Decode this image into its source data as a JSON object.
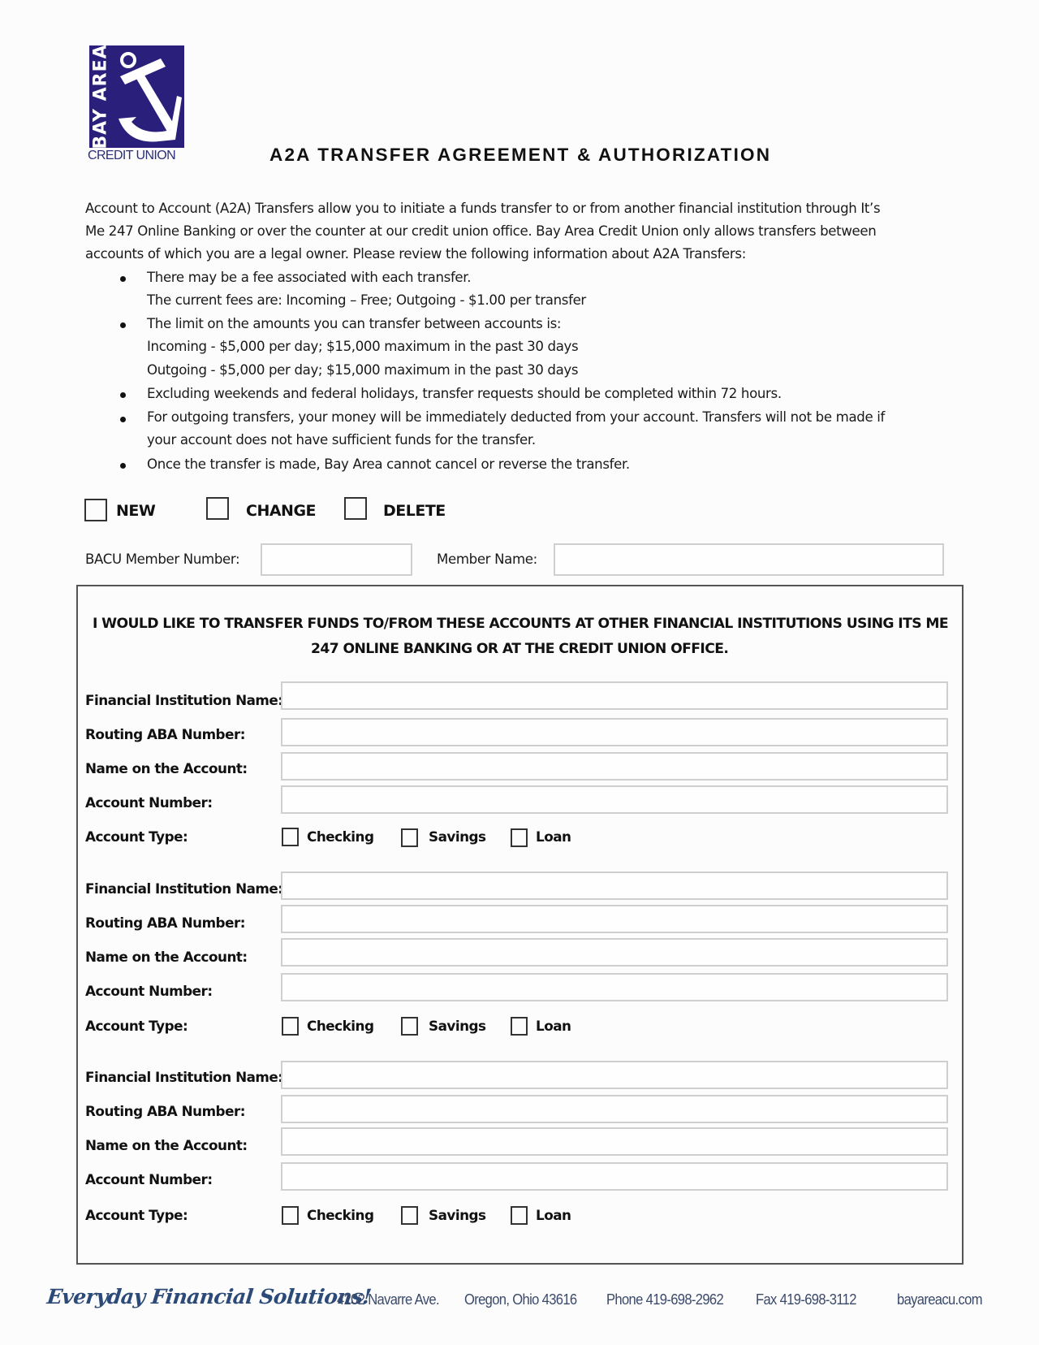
{
  "logo": {
    "vertical_text": "BAY AREA",
    "subtitle": "CREDIT UNION",
    "icon": "anchor-icon",
    "brand_color": "#2a1f7a"
  },
  "title": "A2A TRANSFER AGREEMENT & AUTHORIZATION",
  "intro": {
    "lines": [
      "Account to Account (A2A) Transfers allow you to initiate a funds transfer to or from another financial institution through It’s",
      "Me 247 Online Banking or over the counter at our credit union office.  Bay Area Credit Union only allows transfers between",
      "accounts of which you are a legal owner.  Please review the following information about A2A Transfers:"
    ]
  },
  "bullets": [
    {
      "lines": [
        "There may be a fee associated with each transfer.",
        "The current fees are:  Incoming – Free; Outgoing - $1.00 per transfer"
      ]
    },
    {
      "lines": [
        "The limit on the amounts you can transfer between accounts is:",
        "Incoming - $5,000 per day; $15,000 maximum in the past 30 days",
        "Outgoing - $5,000 per day; $15,000 maximum in the past 30 days"
      ]
    },
    {
      "lines": [
        "Excluding weekends and federal holidays, transfer requests should be completed within 72 hours."
      ]
    },
    {
      "lines": [
        "For outgoing transfers, your money will be immediately deducted from your account.  Transfers will not be made if",
        "your account does not have sufficient funds for the transfer."
      ]
    },
    {
      "lines": [
        "Once the transfer is made, Bay Area cannot cancel or reverse the transfer."
      ]
    }
  ],
  "action_options": [
    {
      "label": "NEW",
      "checked": false
    },
    {
      "label": "CHANGE",
      "checked": false
    },
    {
      "label": "DELETE",
      "checked": false
    }
  ],
  "member": {
    "number_label": "BACU Member Number:",
    "number_value": "",
    "name_label": "Member Name:",
    "name_value": ""
  },
  "accounts_section": {
    "heading_lines": [
      "I WOULD LIKE TO TRANSFER FUNDS TO/FROM THESE ACCOUNTS AT OTHER FINANCIAL INSTITUTIONS USING ITS ME",
      "247 ONLINE BANKING OR AT THE CREDIT UNION OFFICE."
    ],
    "labels": {
      "institution": "Financial Institution Name:",
      "routing": "Routing ABA Number:",
      "name_on_account": "Name on the Account:",
      "account_number": "Account Number:",
      "account_type": "Account Type:"
    },
    "type_options": [
      "Checking",
      "Savings",
      "Loan"
    ],
    "accounts": [
      {
        "institution": "",
        "routing": "",
        "name_on_account": "",
        "account_number": "",
        "type_checked": [
          false,
          false,
          false
        ]
      },
      {
        "institution": "",
        "routing": "",
        "name_on_account": "",
        "account_number": "",
        "type_checked": [
          false,
          false,
          false
        ]
      },
      {
        "institution": "",
        "routing": "",
        "name_on_account": "",
        "account_number": "",
        "type_checked": [
          false,
          false,
          false
        ]
      }
    ]
  },
  "footer": {
    "slogan": "Everyday Financial Solutions!",
    "address": "4202 Navarre Ave.",
    "city": "Oregon, Ohio 43616",
    "phone": "Phone 419-698-2962",
    "fax": "Fax 419-698-3112",
    "website": "bayareacu.com",
    "slogan_color": "#2c4a78"
  }
}
